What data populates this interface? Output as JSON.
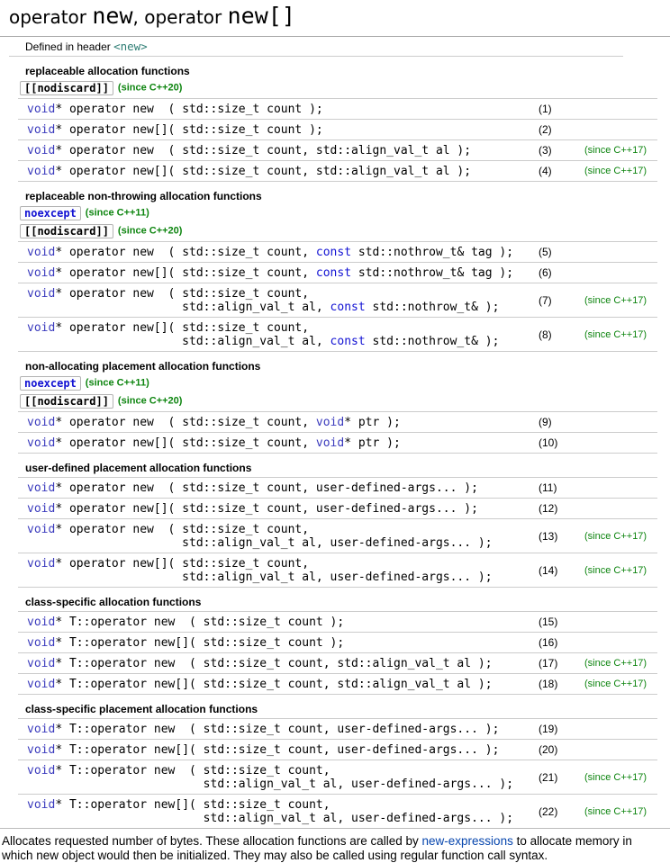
{
  "colors": {
    "kw_void": "#3b3bbd",
    "kw_const": "#1212d3",
    "since_green": "#0e8510",
    "link_blue": "#0645ad",
    "header_teal": "#2e7d74",
    "border_light": "#cccccc",
    "border_dark": "#aaaaaa"
  },
  "title": {
    "parts": [
      {
        "text": "operator ",
        "mono": false
      },
      {
        "text": "new",
        "mono": true
      },
      {
        "text": ", operator ",
        "mono": false
      },
      {
        "text": "new[]",
        "mono": true
      }
    ]
  },
  "defined_in": {
    "label": "Defined in header ",
    "link": "<new>"
  },
  "sections": [
    {
      "heading": "replaceable allocation functions",
      "badges": [
        {
          "label": "[[nodiscard]]",
          "cls": "plain",
          "since": "(since C++20)"
        }
      ],
      "rows": [
        {
          "lines": [
            [
              [
                "void",
                "kw"
              ],
              [
                "* operator new  ( std::size_t count );",
                "pl"
              ]
            ]
          ],
          "num": "(1)",
          "since": ""
        },
        {
          "lines": [
            [
              [
                "void",
                "kw"
              ],
              [
                "* operator new[]( std::size_t count );",
                "pl"
              ]
            ]
          ],
          "num": "(2)",
          "since": ""
        },
        {
          "lines": [
            [
              [
                "void",
                "kw"
              ],
              [
                "* operator new  ( std::size_t count, std::align_val_t al );",
                "pl"
              ]
            ]
          ],
          "num": "(3)",
          "since": "(since C++17)"
        },
        {
          "lines": [
            [
              [
                "void",
                "kw"
              ],
              [
                "* operator new[]( std::size_t count, std::align_val_t al );",
                "pl"
              ]
            ]
          ],
          "num": "(4)",
          "since": "(since C++17)"
        }
      ]
    },
    {
      "heading": "replaceable non-throwing allocation functions",
      "badges": [
        {
          "label": "noexcept",
          "cls": "kw2",
          "since": "(since C++11)"
        },
        {
          "label": "[[nodiscard]]",
          "cls": "plain",
          "since": "(since C++20)"
        }
      ],
      "rows": [
        {
          "lines": [
            [
              [
                "void",
                "kw"
              ],
              [
                "* operator new  ( std::size_t count, ",
                "pl"
              ],
              [
                "const",
                "kw2"
              ],
              [
                " std::nothrow_t& tag );",
                "pl"
              ]
            ]
          ],
          "num": "(5)",
          "since": ""
        },
        {
          "lines": [
            [
              [
                "void",
                "kw"
              ],
              [
                "* operator new[]( std::size_t count, ",
                "pl"
              ],
              [
                "const",
                "kw2"
              ],
              [
                " std::nothrow_t& tag );",
                "pl"
              ]
            ]
          ],
          "num": "(6)",
          "since": ""
        },
        {
          "lines": [
            [
              [
                "void",
                "kw"
              ],
              [
                "* operator new  ( std::size_t count,",
                "pl"
              ]
            ],
            [
              [
                "                      std::align_val_t al, ",
                "pl"
              ],
              [
                "const",
                "kw2"
              ],
              [
                " std::nothrow_t& );",
                "pl"
              ]
            ]
          ],
          "num": "(7)",
          "since": "(since C++17)"
        },
        {
          "lines": [
            [
              [
                "void",
                "kw"
              ],
              [
                "* operator new[]( std::size_t count,",
                "pl"
              ]
            ],
            [
              [
                "                      std::align_val_t al, ",
                "pl"
              ],
              [
                "const",
                "kw2"
              ],
              [
                " std::nothrow_t& );",
                "pl"
              ]
            ]
          ],
          "num": "(8)",
          "since": "(since C++17)"
        }
      ]
    },
    {
      "heading": "non-allocating placement allocation functions",
      "badges": [
        {
          "label": "noexcept",
          "cls": "kw2",
          "since": "(since C++11)"
        },
        {
          "label": "[[nodiscard]]",
          "cls": "plain",
          "since": "(since C++20)"
        }
      ],
      "rows": [
        {
          "lines": [
            [
              [
                "void",
                "kw"
              ],
              [
                "* operator new  ( std::size_t count, ",
                "pl"
              ],
              [
                "void",
                "kw"
              ],
              [
                "* ptr );",
                "pl"
              ]
            ]
          ],
          "num": "(9)",
          "since": ""
        },
        {
          "lines": [
            [
              [
                "void",
                "kw"
              ],
              [
                "* operator new[]( std::size_t count, ",
                "pl"
              ],
              [
                "void",
                "kw"
              ],
              [
                "* ptr );",
                "pl"
              ]
            ]
          ],
          "num": "(10)",
          "since": ""
        }
      ]
    },
    {
      "heading": "user-defined placement allocation functions",
      "badges": [],
      "rows": [
        {
          "lines": [
            [
              [
                "void",
                "kw"
              ],
              [
                "* operator new  ( std::size_t count, user-defined-args... );",
                "pl"
              ]
            ]
          ],
          "num": "(11)",
          "since": ""
        },
        {
          "lines": [
            [
              [
                "void",
                "kw"
              ],
              [
                "* operator new[]( std::size_t count, user-defined-args... );",
                "pl"
              ]
            ]
          ],
          "num": "(12)",
          "since": ""
        },
        {
          "lines": [
            [
              [
                "void",
                "kw"
              ],
              [
                "* operator new  ( std::size_t count,",
                "pl"
              ]
            ],
            [
              [
                "                      std::align_val_t al, user-defined-args... );",
                "pl"
              ]
            ]
          ],
          "num": "(13)",
          "since": "(since C++17)"
        },
        {
          "lines": [
            [
              [
                "void",
                "kw"
              ],
              [
                "* operator new[]( std::size_t count,",
                "pl"
              ]
            ],
            [
              [
                "                      std::align_val_t al, user-defined-args... );",
                "pl"
              ]
            ]
          ],
          "num": "(14)",
          "since": "(since C++17)"
        }
      ]
    },
    {
      "heading": "class-specific allocation functions",
      "badges": [],
      "rows": [
        {
          "lines": [
            [
              [
                "void",
                "kw"
              ],
              [
                "* T::operator new  ( std::size_t count );",
                "pl"
              ]
            ]
          ],
          "num": "(15)",
          "since": ""
        },
        {
          "lines": [
            [
              [
                "void",
                "kw"
              ],
              [
                "* T::operator new[]( std::size_t count );",
                "pl"
              ]
            ]
          ],
          "num": "(16)",
          "since": ""
        },
        {
          "lines": [
            [
              [
                "void",
                "kw"
              ],
              [
                "* T::operator new  ( std::size_t count, std::align_val_t al );",
                "pl"
              ]
            ]
          ],
          "num": "(17)",
          "since": "(since C++17)"
        },
        {
          "lines": [
            [
              [
                "void",
                "kw"
              ],
              [
                "* T::operator new[]( std::size_t count, std::align_val_t al );",
                "pl"
              ]
            ]
          ],
          "num": "(18)",
          "since": "(since C++17)"
        }
      ]
    },
    {
      "heading": "class-specific placement allocation functions",
      "badges": [],
      "rows": [
        {
          "lines": [
            [
              [
                "void",
                "kw"
              ],
              [
                "* T::operator new  ( std::size_t count, user-defined-args... );",
                "pl"
              ]
            ]
          ],
          "num": "(19)",
          "since": ""
        },
        {
          "lines": [
            [
              [
                "void",
                "kw"
              ],
              [
                "* T::operator new[]( std::size_t count, user-defined-args... );",
                "pl"
              ]
            ]
          ],
          "num": "(20)",
          "since": ""
        },
        {
          "lines": [
            [
              [
                "void",
                "kw"
              ],
              [
                "* T::operator new  ( std::size_t count,",
                "pl"
              ]
            ],
            [
              [
                "                         std::align_val_t al, user-defined-args... );",
                "pl"
              ]
            ]
          ],
          "num": "(21)",
          "since": "(since C++17)"
        },
        {
          "lines": [
            [
              [
                "void",
                "kw"
              ],
              [
                "* T::operator new[]( std::size_t count,",
                "pl"
              ]
            ],
            [
              [
                "                         std::align_val_t al, user-defined-args... );",
                "pl"
              ]
            ]
          ],
          "num": "(22)",
          "since": "(since C++17)"
        }
      ]
    }
  ],
  "footer": {
    "line1_before_link": "Allocates requested number of bytes. These allocation functions are called by ",
    "link": "new-expressions",
    "line1_after_link": " to allocate memory in",
    "line2": "which new object would then be initialized. They may also be called using regular function call syntax."
  }
}
